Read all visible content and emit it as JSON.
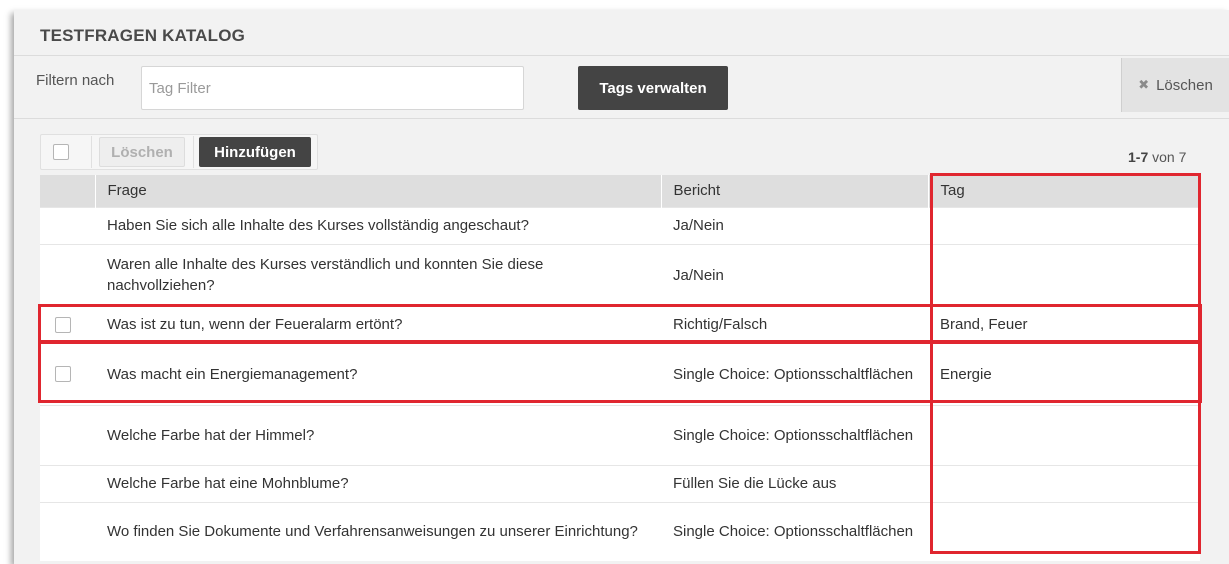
{
  "header": {
    "title": "TESTFRAGEN KATALOG"
  },
  "filter": {
    "label": "Filtern nach",
    "placeholder": "Tag Filter",
    "value": "",
    "manage_tags_label": "Tags verwalten",
    "clear_label": "Löschen",
    "clear_icon": "close-icon"
  },
  "toolbar": {
    "delete_label": "Löschen",
    "add_label": "Hinzufügen",
    "pagination": {
      "range": "1-7",
      "of_label": "von",
      "total": "7"
    }
  },
  "table": {
    "columns": [
      "Frage",
      "Bericht",
      "Tag"
    ],
    "rows": [
      {
        "checkbox": false,
        "question": "Haben Sie sich alle Inhalte des Kurses vollständig angeschaut?",
        "report": "Ja/Nein",
        "tag": ""
      },
      {
        "checkbox": false,
        "question": "Waren alle Inhalte des Kurses verständlich und konnten Sie diese nachvollziehen?",
        "report": "Ja/Nein",
        "tag": ""
      },
      {
        "checkbox": true,
        "question": "Was ist zu tun, wenn der Feueralarm ertönt?",
        "report": "Richtig/Falsch",
        "tag": "Brand, Feuer"
      },
      {
        "checkbox": true,
        "question": "Was macht ein Energiemanagement?",
        "report": "Single Choice: Optionsschaltflächen",
        "tag": "Energie"
      },
      {
        "checkbox": false,
        "question": "Welche Farbe hat der Himmel?",
        "report": "Single Choice: Optionsschaltflächen",
        "tag": ""
      },
      {
        "checkbox": false,
        "question": "Welche Farbe hat eine Mohnblume?",
        "report": "Füllen Sie die Lücke aus",
        "tag": ""
      },
      {
        "checkbox": false,
        "question": "Wo finden Sie Dokumente und Verfahrensanweisungen zu unserer Einrichtung?",
        "report": "Single Choice: Optionsschaltflächen",
        "tag": ""
      }
    ]
  },
  "colors": {
    "highlight": "#e0262f",
    "dark_button": "#444444",
    "header_bg": "#dedede"
  }
}
